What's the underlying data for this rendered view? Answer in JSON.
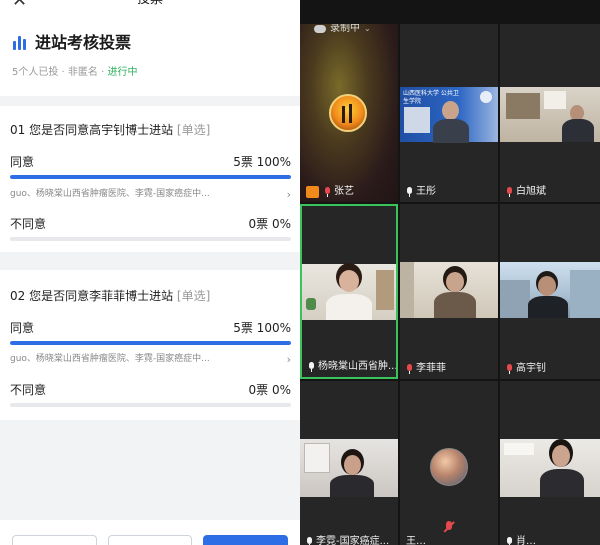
{
  "vote": {
    "nav_title": "投票",
    "close_label": "✕",
    "title": "进站考核投票",
    "meta": {
      "voters": "5个人已投",
      "separator": " · ",
      "anonymity": "非匿名",
      "status": "进行中"
    },
    "questions": [
      {
        "title": "01 您是否同意高宇钊博士进站",
        "type": "[单选]",
        "options": [
          {
            "label": "同意",
            "result": "5票 100%",
            "fraction": 1.0
          },
          {
            "label": "不同意",
            "result": "0票 0%",
            "fraction": 0.0
          }
        ],
        "voters_text": "guo、杨晓棠山西省肿瘤医院、李霓-国家癌症中...",
        "chevron": "›"
      },
      {
        "title": "02 您是否同意李菲菲博士进站",
        "type": "[单选]",
        "options": [
          {
            "label": "同意",
            "result": "5票 100%",
            "fraction": 1.0
          },
          {
            "label": "不同意",
            "result": "0票 0%",
            "fraction": 0.0
          }
        ],
        "voters_text": "guo、杨晓棠山西省肿瘤医院、李霓-国家癌症中...",
        "chevron": "›"
      }
    ],
    "accent_color": "#2d6ee6",
    "status_color": "#2fae5c"
  },
  "meeting": {
    "recording": "录制中",
    "participants": [
      {
        "name": "张艺",
        "mic": "muted-red",
        "badge": "host-icon"
      },
      {
        "name": "王彤",
        "mic": "on"
      },
      {
        "name": "白旭斌",
        "mic": "muted-red"
      },
      {
        "name": "杨晓棠山西省肿...",
        "mic": "on",
        "speaking": true
      },
      {
        "name": "李菲菲",
        "mic": "muted-red"
      },
      {
        "name": "高宇钊",
        "mic": "muted-red"
      },
      {
        "name": "李霓-国家癌症...",
        "mic": "on"
      },
      {
        "name": "王…",
        "mic": "on"
      },
      {
        "name": "肖…",
        "mic": "on"
      }
    ],
    "banner_text": "山西医科大学 公共卫生学院"
  }
}
